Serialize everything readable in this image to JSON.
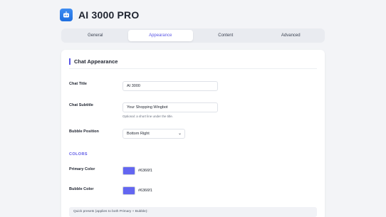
{
  "app": {
    "title": "AI 3000 PRO",
    "logo_icon": "robot-icon"
  },
  "tabs": [
    {
      "label": "General"
    },
    {
      "label": "Appearance"
    },
    {
      "label": "Content"
    },
    {
      "label": "Advanced"
    }
  ],
  "active_tab": "Appearance",
  "section": {
    "title": "Chat Appearance"
  },
  "fields": {
    "chat_title": {
      "label": "Chat Title",
      "value": "AI 3000"
    },
    "chat_subtitle": {
      "label": "Chat Subtitle",
      "value": "Your Shopping Wingbot",
      "hint": "Optional: a short line under the title."
    },
    "bubble_position": {
      "label": "Bubble Position",
      "value": "Bottom Right"
    }
  },
  "colors": {
    "heading": "COLORS",
    "primary": {
      "label": "Primary Color",
      "hex": "#6366f1"
    },
    "bubble": {
      "label": "Bubble Color",
      "hex": "#6366f1"
    }
  },
  "presets": {
    "text": "Quick presets (applies to both Primary + Bubble):"
  },
  "theme": {
    "accent": "#5b57e6",
    "logo_blue": "#2f7fe9"
  }
}
